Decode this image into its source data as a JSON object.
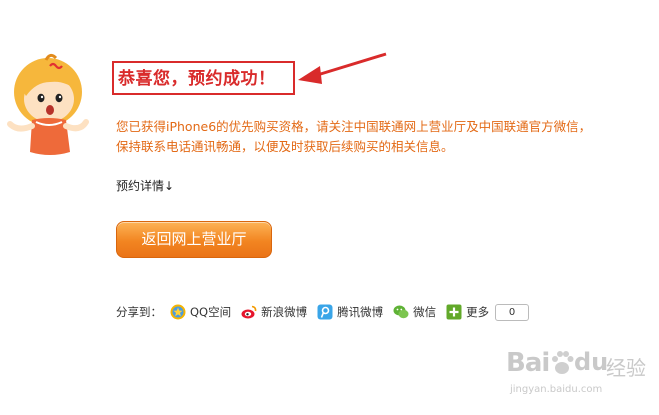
{
  "heading": {
    "title": "恭喜您，预约成功！"
  },
  "message": {
    "line1": "您已获得iPhone6的优先购买资格，请关注中国联通网上营业厅及中国联通官方微信，",
    "line2": "保持联系电话通讯畅通，以便及时获取后续购买的相关信息。"
  },
  "details": {
    "label": "预约详情↓"
  },
  "actions": {
    "return_label": "返回网上营业厅"
  },
  "share": {
    "label": "分享到：",
    "items": [
      {
        "label": "QQ空间",
        "icon": "qzone-icon",
        "color": "#f5b400"
      },
      {
        "label": "新浪微博",
        "icon": "sina-weibo-icon",
        "color": "#e6162d"
      },
      {
        "label": "腾讯微博",
        "icon": "tencent-weibo-icon",
        "color": "#3aa5e8"
      },
      {
        "label": "微信",
        "icon": "wechat-icon",
        "color": "#5fb236"
      },
      {
        "label": "更多",
        "icon": "plus-icon",
        "color": "#62a92a"
      }
    ],
    "count": "0"
  },
  "watermark": {
    "brand": "Bai",
    "brand2": "du",
    "suffix": "经验",
    "url": "jingyan.baidu.com"
  },
  "colors": {
    "accent": "#d92b2b",
    "text_orange": "#e36a16",
    "button": "#f28521"
  }
}
